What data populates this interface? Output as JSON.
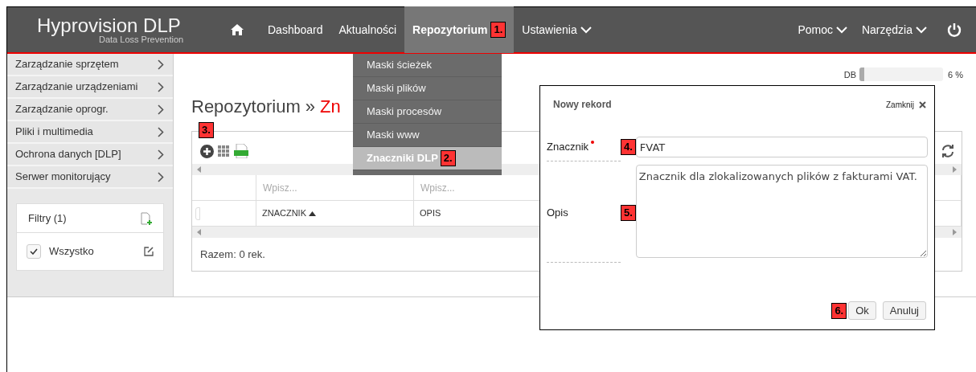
{
  "brand": {
    "name": "Hyprovision DLP",
    "tagline": "Data Loss Prevention"
  },
  "nav": {
    "items": [
      {
        "label": "Dashboard",
        "selected": false,
        "has_menu": false
      },
      {
        "label": "Aktualności",
        "selected": false,
        "has_menu": false
      },
      {
        "label": "Repozytorium",
        "selected": true,
        "has_menu": false,
        "marker": "1."
      },
      {
        "label": "Ustawienia",
        "selected": false,
        "has_menu": true
      }
    ],
    "right": [
      {
        "label": "Pomoc"
      },
      {
        "label": "Narzędzia"
      }
    ]
  },
  "dropdown": [
    {
      "label": "Maski ścieżek",
      "selected": false
    },
    {
      "label": "Maski plików",
      "selected": false
    },
    {
      "label": "Maski procesów",
      "selected": false
    },
    {
      "label": "Maski www",
      "selected": false
    },
    {
      "label": "Znaczniki DLP",
      "selected": true,
      "marker": "2."
    }
  ],
  "sidebar": {
    "items": [
      "Zarządzanie sprzętem",
      "Zarządzanie urządzeniami",
      "Zarządzanie oprogr.",
      "Pliki i multimedia",
      "Ochrona danych [DLP]",
      "Serwer monitorujący"
    ],
    "filters": {
      "title": "Filtry (1)",
      "items": [
        {
          "label": "Wszystko",
          "checked": true
        }
      ]
    }
  },
  "usage": {
    "label": "DB",
    "level": 0.06,
    "reading": "6 %"
  },
  "page": {
    "breadcrumb": "Repozytorium »",
    "current": "Zn"
  },
  "toolbar": {
    "marker": "3."
  },
  "table": {
    "filter_placeholders": [
      "Wpisz...",
      "Wpisz..."
    ],
    "columns": [
      {
        "label": "ZNACZNIK",
        "sorted": true
      },
      {
        "label": "OPIS",
        "sorted": false
      }
    ],
    "footer": "Razem: 0 rek."
  },
  "dialog": {
    "title": "Nowy rekord",
    "close": "Zamknij",
    "fields": [
      {
        "kind": "text",
        "label": "Znacznik",
        "required": true,
        "marker": "4.",
        "value": "FVAT"
      },
      {
        "kind": "textarea",
        "label": "Opis",
        "required": false,
        "marker": "5.",
        "value": "Znacznik dla zlokalizowanych plików z fakturami VAT."
      }
    ],
    "buttons_marker": "6.",
    "buttons": [
      "Ok",
      "Anuluj"
    ]
  }
}
